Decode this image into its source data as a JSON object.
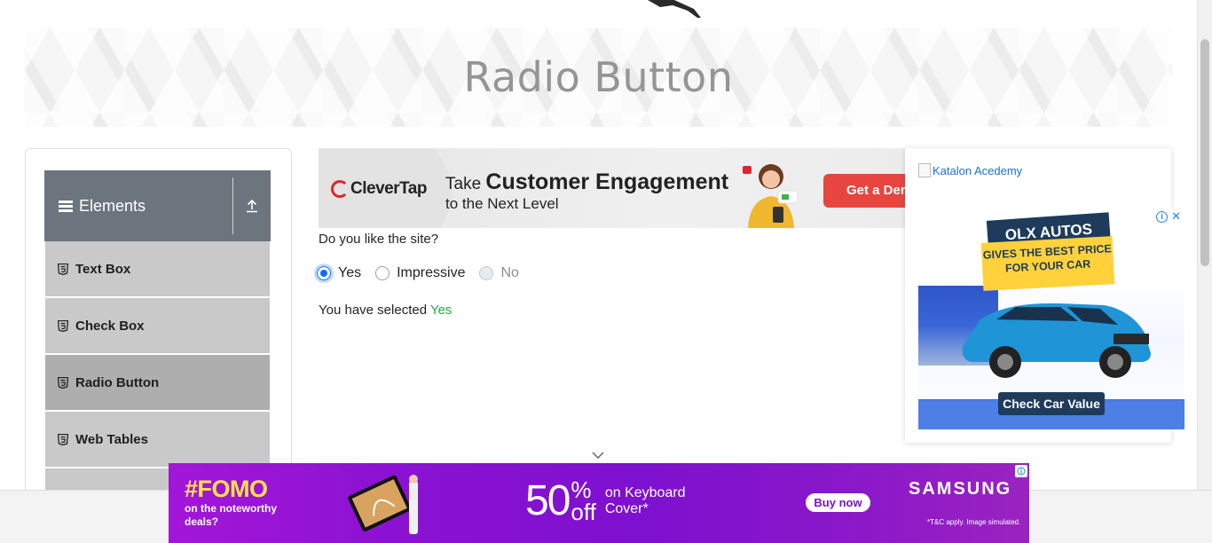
{
  "header": {
    "title": "Radio Button"
  },
  "sidebar": {
    "group_title": "Elements",
    "items": [
      {
        "label": "Text Box"
      },
      {
        "label": "Check Box"
      },
      {
        "label": "Radio Button"
      },
      {
        "label": "Web Tables"
      }
    ]
  },
  "top_ad": {
    "brand": "CleverTap",
    "tagline_prefix": "Take ",
    "tagline_bold": "Customer Engagement",
    "tagline_line2": "to the Next Level",
    "cta": "Get a Demo"
  },
  "form": {
    "question": "Do you like the site?",
    "options": [
      {
        "label": "Yes",
        "checked": true,
        "disabled": false
      },
      {
        "label": "Impressive",
        "checked": false,
        "disabled": false
      },
      {
        "label": "No",
        "checked": false,
        "disabled": true
      }
    ],
    "result_prefix": "You have selected ",
    "result_value": "Yes"
  },
  "right_ad": {
    "katalon_alt": "Katalon Acedemy",
    "olx_title": "OLX AUTOS",
    "olx_slogan_line1": "GIVES THE BEST PRICE",
    "olx_slogan_line2": "FOR YOUR CAR",
    "olx_cta": "Check Car Value"
  },
  "bottom_ad": {
    "headline": "#FOMO",
    "sub_line1": "on the noteworthy",
    "sub_line2": "deals?",
    "percent": "50",
    "pct_sign": "%",
    "off": "off",
    "desc_line1": "on Keyboard",
    "desc_line2": "Cover*",
    "buy_label": "Buy now",
    "brand": "SAMSUNG",
    "terms": "*T&C apply. Image simulated."
  },
  "colors": {
    "sidebar_header": "#6c757d",
    "menu_item": "#c9c9c9",
    "menu_item_active": "#aeaeae",
    "radio_accent": "#0d6efd",
    "result_value": "#28a745",
    "bottom_ad_purple": "#7e10cf",
    "fomo_yellow": "#ffe14a"
  }
}
